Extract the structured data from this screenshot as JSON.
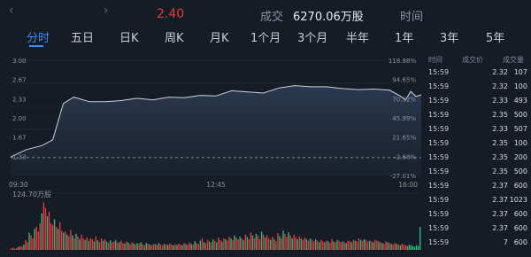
{
  "header": {
    "back_chevron": "‹",
    "forward_chevron": "›",
    "price": "2.40",
    "volume_label": "成交",
    "volume_value": "6270.06万股",
    "time_label": "时间"
  },
  "tabs": [
    "分时",
    "五日",
    "日K",
    "周K",
    "月K",
    "1个月",
    "3个月",
    "半年",
    "1年",
    "3年",
    "5年"
  ],
  "active_tab": "分时",
  "chart_data": [
    {
      "type": "area",
      "y_ticks_left": [
        "3.00",
        "2.67",
        "2.33",
        "2.00",
        "1.67",
        "1.33"
      ],
      "y_ticks_right": [
        "118.98%",
        "94.65%",
        "70.32%",
        "45.99%",
        "21.65%",
        "-2.68%",
        "-27.01%"
      ],
      "x_ticks": [
        "09:30",
        "12:45",
        "16:00"
      ],
      "ylim": [
        1.0,
        3.0
      ],
      "reference_line": 1.31,
      "series": [
        {
          "x": [
            "09:30",
            "09:45",
            "10:00",
            "10:10",
            "10:20",
            "10:30",
            "10:45",
            "11:00",
            "11:15",
            "11:30",
            "11:45",
            "12:00",
            "12:15",
            "12:30",
            "12:45",
            "13:00",
            "13:15",
            "13:30",
            "13:45",
            "14:00",
            "14:15",
            "14:30",
            "14:45",
            "15:00",
            "15:15",
            "15:30",
            "15:40",
            "15:45",
            "15:50",
            "15:55",
            "16:00"
          ],
          "values": [
            1.32,
            1.45,
            1.52,
            1.62,
            2.25,
            2.36,
            2.28,
            2.28,
            2.3,
            2.34,
            2.31,
            2.36,
            2.35,
            2.39,
            2.38,
            2.47,
            2.45,
            2.43,
            2.52,
            2.56,
            2.54,
            2.54,
            2.51,
            2.49,
            2.5,
            2.48,
            2.38,
            2.31,
            2.46,
            2.37,
            2.4
          ]
        }
      ]
    },
    {
      "type": "bar",
      "title": "124.70万股",
      "x_ticks": [
        "09:30",
        "16:00"
      ],
      "ylim": [
        0,
        124.7
      ],
      "values": [
        4,
        6,
        3,
        5,
        8,
        10,
        9,
        14,
        25,
        20,
        45,
        38,
        30,
        55,
        60,
        48,
        70,
        95,
        124,
        110,
        88,
        100,
        70,
        65,
        80,
        60,
        55,
        72,
        50,
        45,
        48,
        40,
        35,
        52,
        38,
        30,
        42,
        35,
        28,
        40,
        30,
        26,
        33,
        24,
        30,
        28,
        22,
        35,
        25,
        20,
        30,
        24,
        28,
        22,
        18,
        25,
        20,
        22,
        26,
        18,
        20,
        24,
        18,
        16,
        22,
        19,
        15,
        20,
        17,
        14,
        18,
        16,
        20,
        15,
        13,
        18,
        16,
        14,
        12,
        16,
        15,
        13,
        18,
        14,
        12,
        16,
        14,
        13,
        17,
        14,
        12,
        15,
        13,
        16,
        14,
        12,
        18,
        15,
        13,
        20,
        16,
        14,
        22,
        17,
        15,
        24,
        30,
        20,
        18,
        26,
        22,
        19,
        28,
        24,
        20,
        32,
        26,
        22,
        30,
        28,
        24,
        34,
        30,
        26,
        38,
        32,
        28,
        35,
        30,
        25,
        40,
        34,
        28,
        45,
        38,
        30,
        42,
        36,
        28,
        48,
        40,
        32,
        38,
        30,
        26,
        34,
        28,
        22,
        44,
        36,
        30,
        50,
        42,
        34,
        46,
        38,
        30,
        40,
        34,
        28,
        36,
        30,
        26,
        32,
        28,
        24,
        30,
        26,
        22,
        28,
        24,
        20,
        26,
        22,
        20,
        24,
        22,
        18,
        28,
        22,
        20,
        26,
        24,
        20,
        22,
        20,
        18,
        24,
        22,
        20,
        26,
        24,
        22,
        30,
        26,
        24,
        28,
        26,
        22,
        24,
        22,
        20,
        26,
        24,
        22,
        20,
        18,
        16,
        22,
        20,
        18,
        16,
        14,
        18,
        16,
        14,
        12,
        16,
        14,
        12,
        10,
        14,
        12,
        10,
        8,
        12,
        10,
        60
      ],
      "colors": [
        "red",
        "red",
        "green",
        "red",
        "green",
        "red",
        "red",
        "green",
        "red",
        "red",
        "green",
        "red",
        "red",
        "green",
        "red",
        "red",
        "red",
        "green",
        "red",
        "red",
        "green",
        "red",
        "red",
        "red",
        "green",
        "red",
        "green",
        "red",
        "red",
        "green",
        "red",
        "green",
        "red",
        "red",
        "green",
        "red",
        "green",
        "red",
        "green",
        "red",
        "red",
        "green",
        "red",
        "green",
        "red",
        "red",
        "green",
        "red",
        "green",
        "red",
        "red",
        "green",
        "red",
        "green",
        "red",
        "green",
        "red",
        "red",
        "green",
        "red",
        "green",
        "red",
        "red",
        "green",
        "red",
        "green",
        "red",
        "red",
        "green",
        "red",
        "green",
        "red",
        "green",
        "red",
        "red",
        "green",
        "red",
        "green",
        "red",
        "red",
        "green",
        "red",
        "green",
        "red",
        "red",
        "green",
        "red",
        "green",
        "red",
        "red",
        "green",
        "red",
        "green",
        "red",
        "red",
        "green",
        "red",
        "green",
        "red",
        "red",
        "green",
        "red",
        "green",
        "red",
        "red",
        "green",
        "red",
        "green",
        "red",
        "red",
        "green",
        "red",
        "green",
        "red",
        "green",
        "red",
        "red",
        "green",
        "red",
        "green",
        "red",
        "red",
        "green",
        "red",
        "green",
        "red",
        "red",
        "green",
        "red",
        "green",
        "red",
        "green",
        "red",
        "red",
        "green",
        "red",
        "green",
        "red",
        "red",
        "green",
        "red",
        "green",
        "red",
        "red",
        "green",
        "red",
        "green",
        "red",
        "red",
        "green",
        "red",
        "green",
        "red",
        "red",
        "green",
        "red",
        "green",
        "red",
        "red",
        "green",
        "red",
        "green",
        "red",
        "red",
        "green",
        "red",
        "green",
        "red",
        "red",
        "green",
        "red",
        "green",
        "red",
        "red",
        "green",
        "red",
        "green",
        "red",
        "red",
        "green",
        "red",
        "green",
        "red",
        "red",
        "green",
        "red",
        "green",
        "red",
        "red",
        "green",
        "red",
        "green",
        "red",
        "red",
        "green",
        "red",
        "green",
        "red",
        "red",
        "green",
        "red",
        "green",
        "red",
        "red",
        "green",
        "red",
        "green",
        "red",
        "red",
        "green",
        "red",
        "green",
        "red",
        "red",
        "green",
        "red",
        "green",
        "red",
        "red",
        "red"
      ]
    }
  ],
  "trades": {
    "headers": [
      "时间",
      "成交价",
      "成交量"
    ],
    "rows": [
      {
        "time": "15:59",
        "price": "2.32",
        "vol": "107"
      },
      {
        "time": "15:59",
        "price": "2.32",
        "vol": "100"
      },
      {
        "time": "15:59",
        "price": "2.33",
        "vol": "493"
      },
      {
        "time": "15:59",
        "price": "2.35",
        "vol": "500"
      },
      {
        "time": "15:59",
        "price": "2.33",
        "vol": "507"
      },
      {
        "time": "15:59",
        "price": "2.35",
        "vol": "100"
      },
      {
        "time": "15:59",
        "price": "2.35",
        "vol": "200"
      },
      {
        "time": "15:59",
        "price": "2.35",
        "vol": "500"
      },
      {
        "time": "15:59",
        "price": "2.37",
        "vol": "600"
      },
      {
        "time": "15:59",
        "price": "2.37",
        "vol": "1023"
      },
      {
        "time": "15:59",
        "price": "2.37",
        "vol": "600"
      },
      {
        "time": "15:59",
        "price": "2.37",
        "vol": "600"
      },
      {
        "time": "15:59",
        "price": "7",
        "vol": "600"
      }
    ]
  },
  "colors": {
    "background": "#161c26",
    "accent": "#3d8cf5",
    "up": "#e4393c",
    "down": "#2fb37a",
    "line": "#c9d2de"
  }
}
